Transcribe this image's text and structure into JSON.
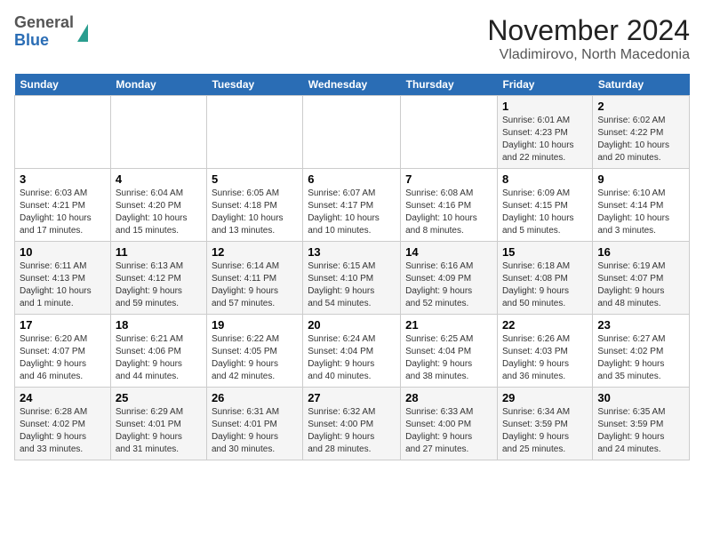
{
  "header": {
    "logo_general": "General",
    "logo_blue": "Blue",
    "title": "November 2024",
    "subtitle": "Vladimirovo, North Macedonia"
  },
  "days_of_week": [
    "Sunday",
    "Monday",
    "Tuesday",
    "Wednesday",
    "Thursday",
    "Friday",
    "Saturday"
  ],
  "weeks": [
    [
      {
        "day": "",
        "info": ""
      },
      {
        "day": "",
        "info": ""
      },
      {
        "day": "",
        "info": ""
      },
      {
        "day": "",
        "info": ""
      },
      {
        "day": "",
        "info": ""
      },
      {
        "day": "1",
        "info": "Sunrise: 6:01 AM\nSunset: 4:23 PM\nDaylight: 10 hours\nand 22 minutes."
      },
      {
        "day": "2",
        "info": "Sunrise: 6:02 AM\nSunset: 4:22 PM\nDaylight: 10 hours\nand 20 minutes."
      }
    ],
    [
      {
        "day": "3",
        "info": "Sunrise: 6:03 AM\nSunset: 4:21 PM\nDaylight: 10 hours\nand 17 minutes."
      },
      {
        "day": "4",
        "info": "Sunrise: 6:04 AM\nSunset: 4:20 PM\nDaylight: 10 hours\nand 15 minutes."
      },
      {
        "day": "5",
        "info": "Sunrise: 6:05 AM\nSunset: 4:18 PM\nDaylight: 10 hours\nand 13 minutes."
      },
      {
        "day": "6",
        "info": "Sunrise: 6:07 AM\nSunset: 4:17 PM\nDaylight: 10 hours\nand 10 minutes."
      },
      {
        "day": "7",
        "info": "Sunrise: 6:08 AM\nSunset: 4:16 PM\nDaylight: 10 hours\nand 8 minutes."
      },
      {
        "day": "8",
        "info": "Sunrise: 6:09 AM\nSunset: 4:15 PM\nDaylight: 10 hours\nand 5 minutes."
      },
      {
        "day": "9",
        "info": "Sunrise: 6:10 AM\nSunset: 4:14 PM\nDaylight: 10 hours\nand 3 minutes."
      }
    ],
    [
      {
        "day": "10",
        "info": "Sunrise: 6:11 AM\nSunset: 4:13 PM\nDaylight: 10 hours\nand 1 minute."
      },
      {
        "day": "11",
        "info": "Sunrise: 6:13 AM\nSunset: 4:12 PM\nDaylight: 9 hours\nand 59 minutes."
      },
      {
        "day": "12",
        "info": "Sunrise: 6:14 AM\nSunset: 4:11 PM\nDaylight: 9 hours\nand 57 minutes."
      },
      {
        "day": "13",
        "info": "Sunrise: 6:15 AM\nSunset: 4:10 PM\nDaylight: 9 hours\nand 54 minutes."
      },
      {
        "day": "14",
        "info": "Sunrise: 6:16 AM\nSunset: 4:09 PM\nDaylight: 9 hours\nand 52 minutes."
      },
      {
        "day": "15",
        "info": "Sunrise: 6:18 AM\nSunset: 4:08 PM\nDaylight: 9 hours\nand 50 minutes."
      },
      {
        "day": "16",
        "info": "Sunrise: 6:19 AM\nSunset: 4:07 PM\nDaylight: 9 hours\nand 48 minutes."
      }
    ],
    [
      {
        "day": "17",
        "info": "Sunrise: 6:20 AM\nSunset: 4:07 PM\nDaylight: 9 hours\nand 46 minutes."
      },
      {
        "day": "18",
        "info": "Sunrise: 6:21 AM\nSunset: 4:06 PM\nDaylight: 9 hours\nand 44 minutes."
      },
      {
        "day": "19",
        "info": "Sunrise: 6:22 AM\nSunset: 4:05 PM\nDaylight: 9 hours\nand 42 minutes."
      },
      {
        "day": "20",
        "info": "Sunrise: 6:24 AM\nSunset: 4:04 PM\nDaylight: 9 hours\nand 40 minutes."
      },
      {
        "day": "21",
        "info": "Sunrise: 6:25 AM\nSunset: 4:04 PM\nDaylight: 9 hours\nand 38 minutes."
      },
      {
        "day": "22",
        "info": "Sunrise: 6:26 AM\nSunset: 4:03 PM\nDaylight: 9 hours\nand 36 minutes."
      },
      {
        "day": "23",
        "info": "Sunrise: 6:27 AM\nSunset: 4:02 PM\nDaylight: 9 hours\nand 35 minutes."
      }
    ],
    [
      {
        "day": "24",
        "info": "Sunrise: 6:28 AM\nSunset: 4:02 PM\nDaylight: 9 hours\nand 33 minutes."
      },
      {
        "day": "25",
        "info": "Sunrise: 6:29 AM\nSunset: 4:01 PM\nDaylight: 9 hours\nand 31 minutes."
      },
      {
        "day": "26",
        "info": "Sunrise: 6:31 AM\nSunset: 4:01 PM\nDaylight: 9 hours\nand 30 minutes."
      },
      {
        "day": "27",
        "info": "Sunrise: 6:32 AM\nSunset: 4:00 PM\nDaylight: 9 hours\nand 28 minutes."
      },
      {
        "day": "28",
        "info": "Sunrise: 6:33 AM\nSunset: 4:00 PM\nDaylight: 9 hours\nand 27 minutes."
      },
      {
        "day": "29",
        "info": "Sunrise: 6:34 AM\nSunset: 3:59 PM\nDaylight: 9 hours\nand 25 minutes."
      },
      {
        "day": "30",
        "info": "Sunrise: 6:35 AM\nSunset: 3:59 PM\nDaylight: 9 hours\nand 24 minutes."
      }
    ]
  ]
}
